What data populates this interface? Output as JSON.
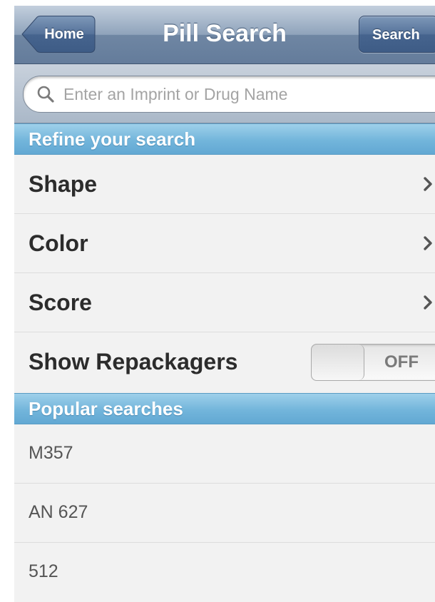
{
  "navbar": {
    "back_label": "Home",
    "title": "Pill Search",
    "search_label": "Search"
  },
  "search": {
    "placeholder": "Enter an Imprint or Drug Name",
    "value": ""
  },
  "refine": {
    "header": "Refine your search",
    "items": [
      {
        "label": "Shape"
      },
      {
        "label": "Color"
      },
      {
        "label": "Score"
      }
    ],
    "repackagers": {
      "label": "Show Repackagers",
      "state": "OFF"
    }
  },
  "popular": {
    "header": "Popular searches",
    "items": [
      {
        "label": "M357"
      },
      {
        "label": "AN 627"
      },
      {
        "label": "512"
      }
    ]
  },
  "colors": {
    "navbar": "#6f86a3",
    "section_header": "#72b5db",
    "row_background": "#f2f2f2"
  },
  "icons": {
    "search": "magnifying-glass-icon",
    "disclosure": "chevron-right-icon",
    "back": "back-arrow-button"
  }
}
